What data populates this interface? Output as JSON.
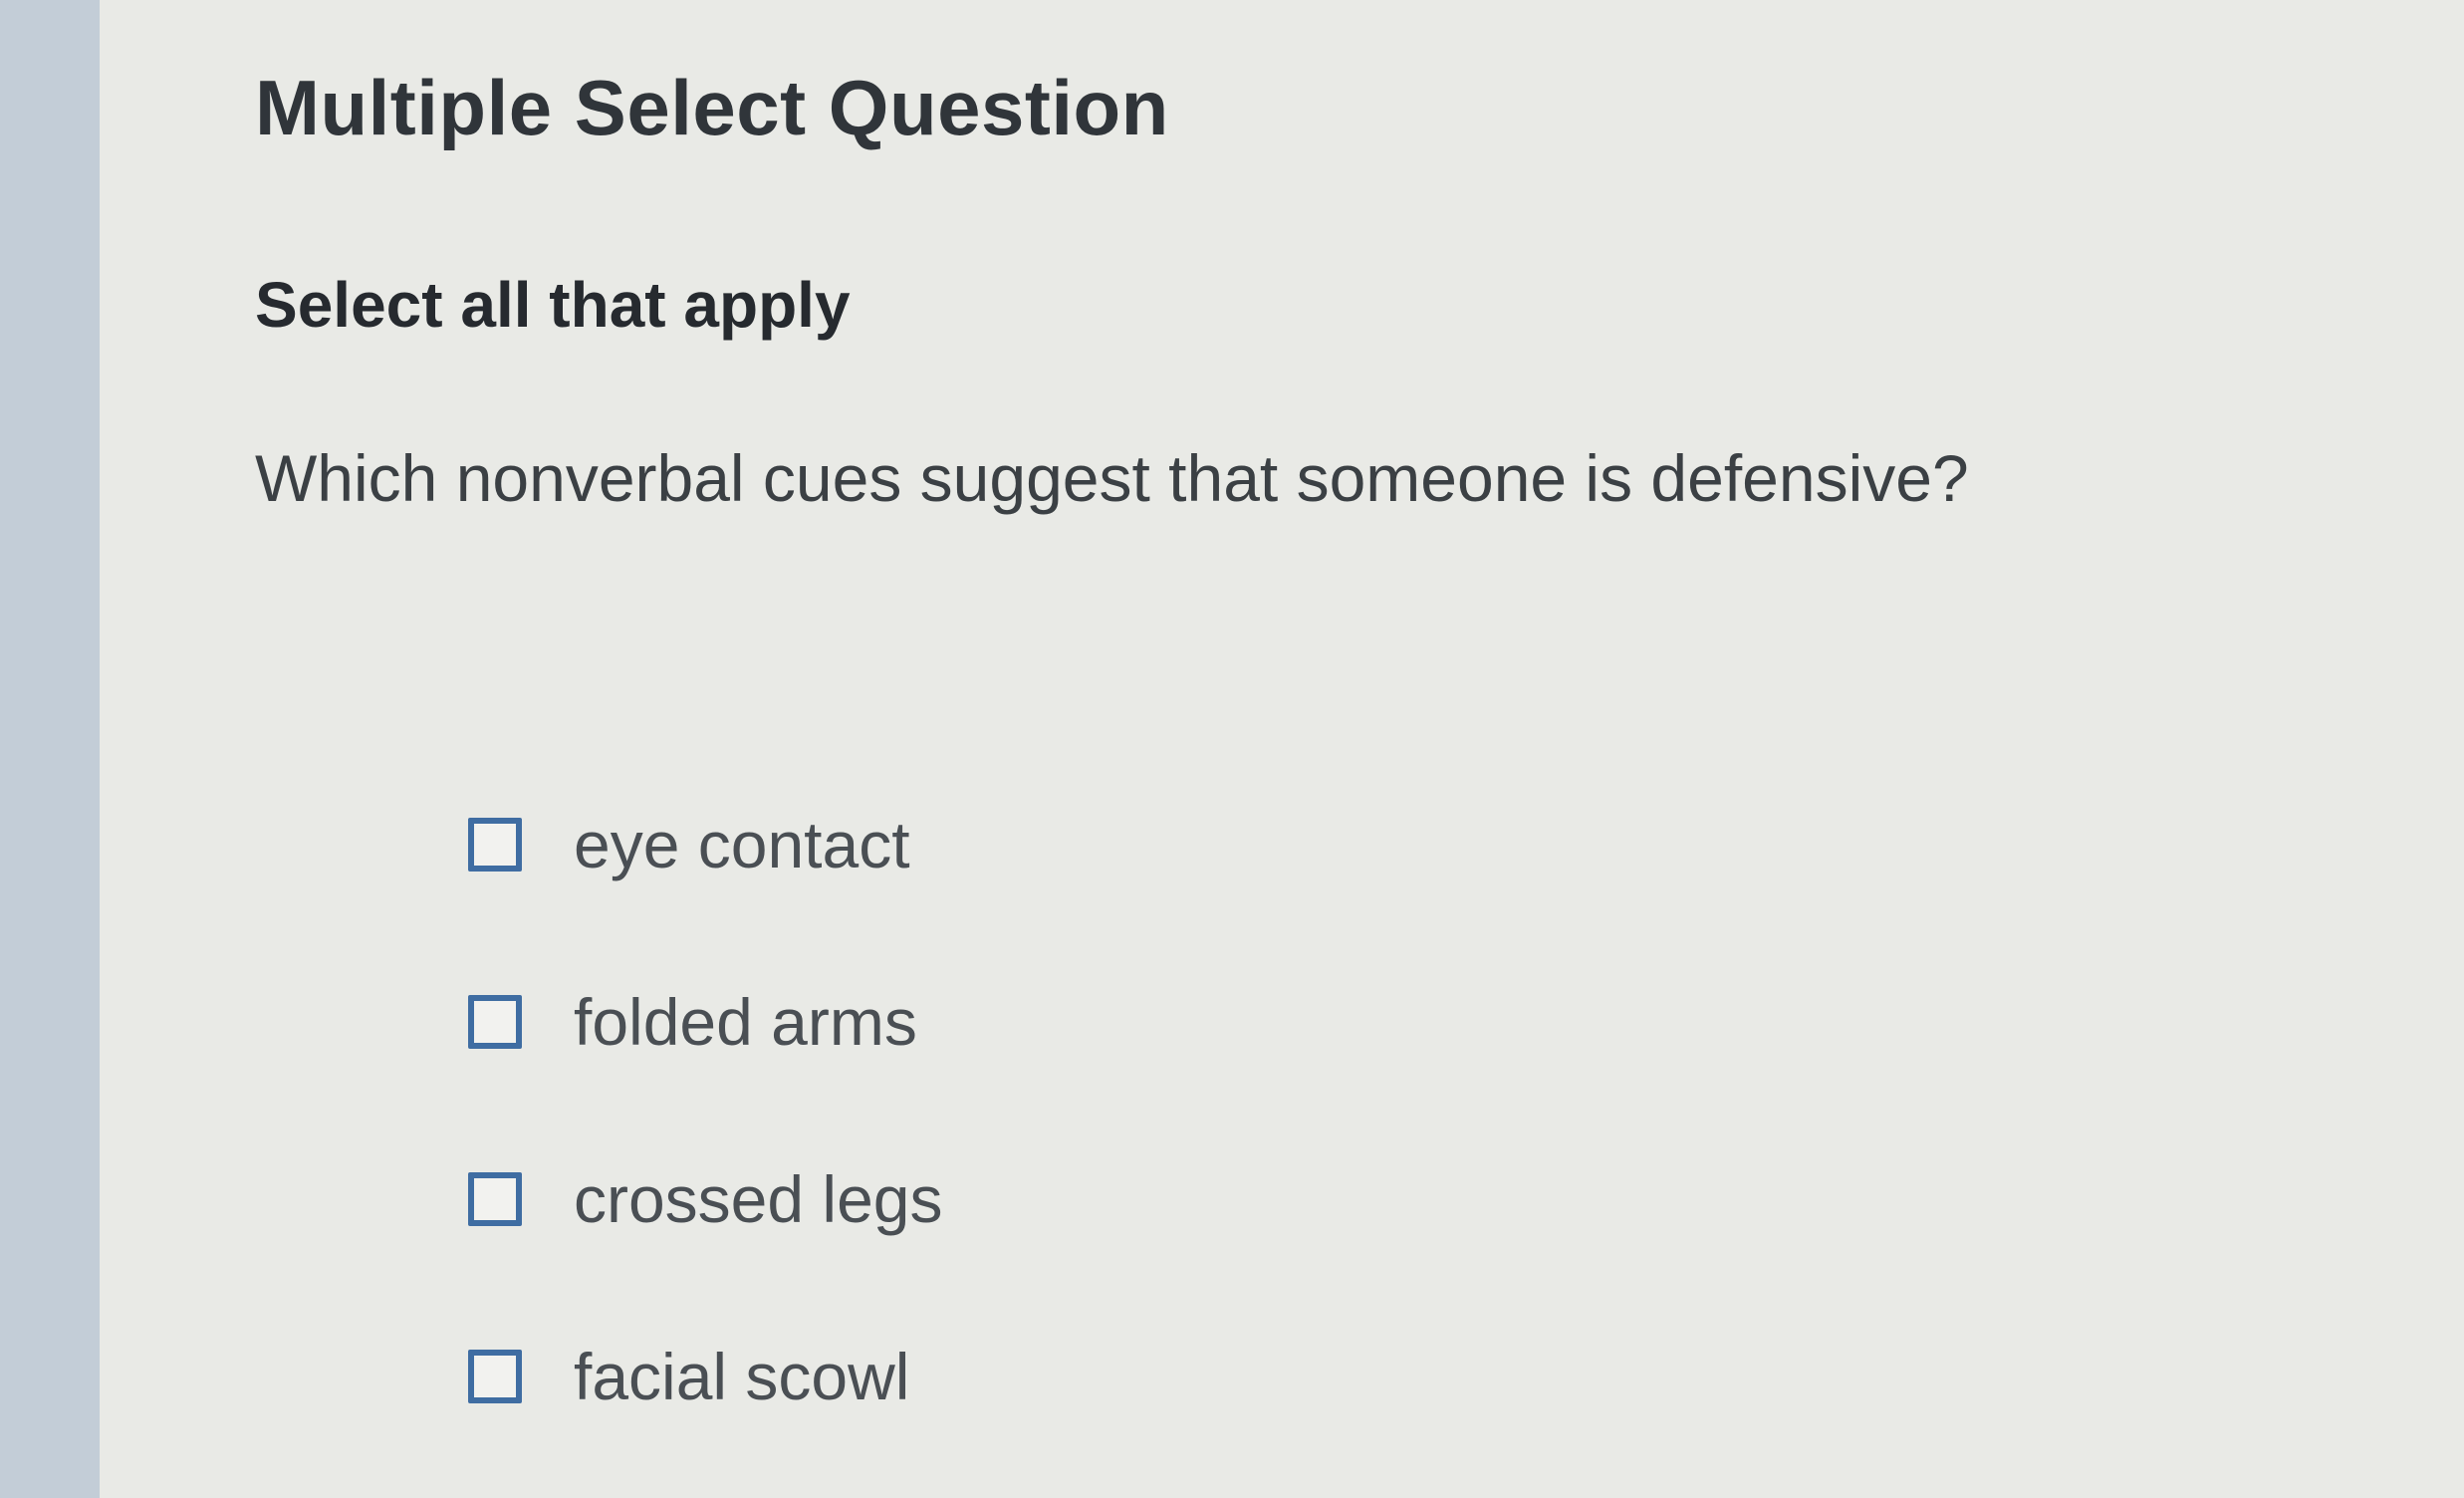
{
  "question": {
    "heading": "Multiple Select Question",
    "instruction": "Select all that apply",
    "prompt": "Which nonverbal cues suggest that someone is defensive?"
  },
  "choices": [
    {
      "label": "eye contact",
      "checked": false
    },
    {
      "label": "folded arms",
      "checked": false
    },
    {
      "label": "crossed legs",
      "checked": false
    },
    {
      "label": "facial scowl",
      "checked": false
    }
  ],
  "colors": {
    "checkbox_border": "#3f6da2",
    "heading_text": "#30353a",
    "body_text": "#3b4044"
  }
}
